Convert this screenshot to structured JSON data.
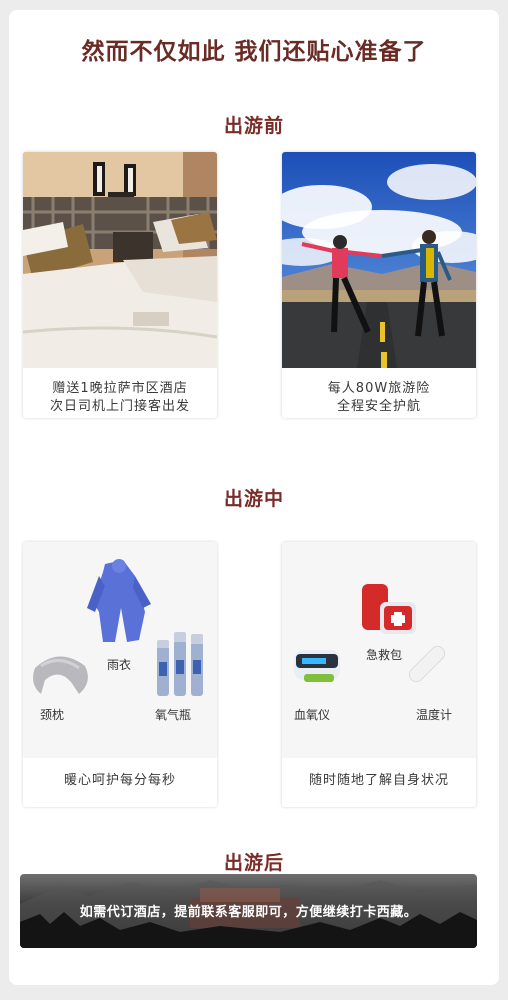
{
  "header": {
    "title": "然而不仅如此 我们还贴心准备了"
  },
  "before_trip": {
    "title": "出游前",
    "cards": [
      {
        "caption_line1": "赠送1晚拉萨市区酒店",
        "caption_line2": "次日司机上门接客出发"
      },
      {
        "caption_line1": "每人80W旅游险",
        "caption_line2": "全程安全护航"
      }
    ]
  },
  "during_trip": {
    "title": "出游中",
    "cards": [
      {
        "items": [
          "雨衣",
          "颈枕",
          "氧气瓶"
        ],
        "caption": "暖心呵护每分每秒"
      },
      {
        "items": [
          "急救包",
          "血氧仪",
          "温度计"
        ],
        "caption": "随时随地了解自身状况"
      }
    ]
  },
  "after_trip": {
    "title": "出游后",
    "banner_text": "如需代订酒店，提前联系客服即可，方便继续打卡西藏。"
  }
}
